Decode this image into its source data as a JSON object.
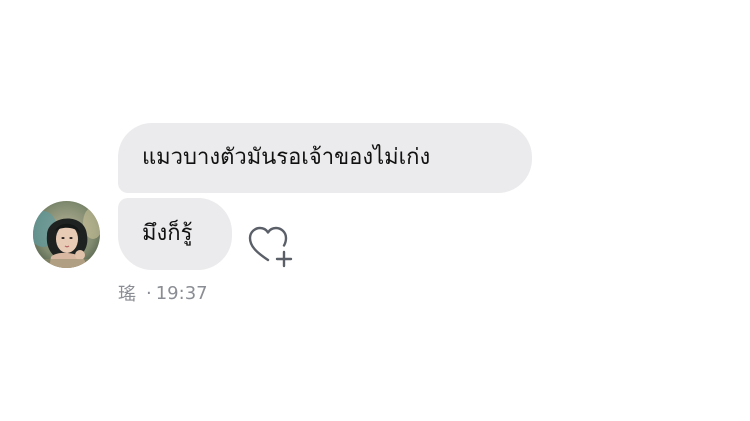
{
  "chat": {
    "messages": [
      {
        "text": "แมวบางตัวมันรอเจ้าของไม่เก่ง"
      },
      {
        "text": "มึงก็รู้"
      }
    ],
    "sender": {
      "name": "瑤",
      "avatar_icon": "user-avatar-photo"
    },
    "timestamp": "19:37",
    "separator": "·",
    "reaction_icon": "heart-add-icon"
  },
  "colors": {
    "background": "#ffffff",
    "bubble": "#ebebed",
    "message_text": "#111111",
    "meta_text": "#8a8d93",
    "icon_stroke": "#5a5f68"
  }
}
